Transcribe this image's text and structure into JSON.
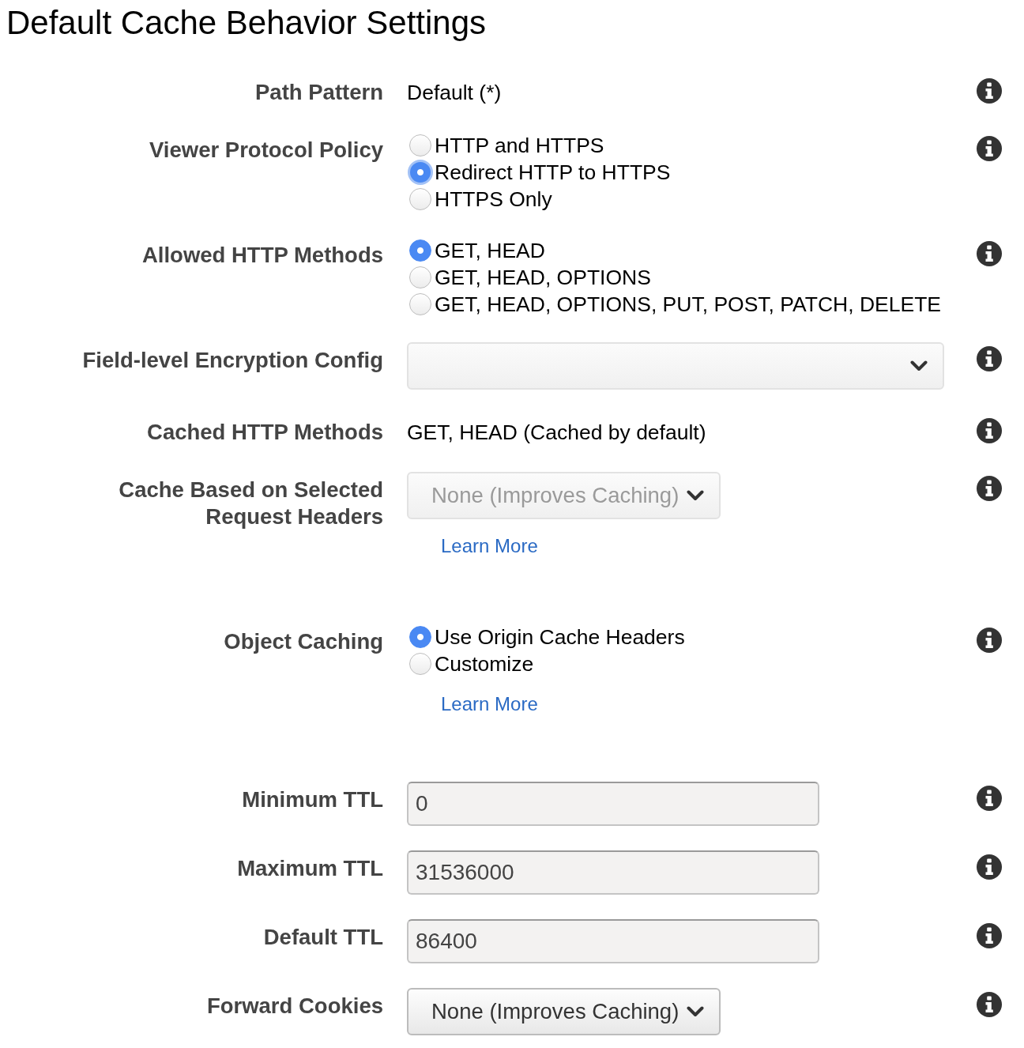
{
  "title": "Default Cache Behavior Settings",
  "fields": [
    {
      "kind": "text",
      "label": "Path Pattern",
      "value": "Default (*)"
    },
    {
      "kind": "radio",
      "label": "Viewer Protocol Policy",
      "options": [
        {
          "label": "HTTP and HTTPS",
          "selected": false,
          "focused": false
        },
        {
          "label": "Redirect HTTP to HTTPS",
          "selected": true,
          "focused": true
        },
        {
          "label": "HTTPS Only",
          "selected": false,
          "focused": false
        }
      ]
    },
    {
      "kind": "radio",
      "label": "Allowed HTTP Methods",
      "options": [
        {
          "label": "GET, HEAD",
          "selected": true
        },
        {
          "label": "GET, HEAD, OPTIONS",
          "selected": false
        },
        {
          "label": "GET, HEAD, OPTIONS, PUT, POST, PATCH, DELETE",
          "selected": false
        }
      ]
    },
    {
      "kind": "select",
      "label": "Field-level Encryption Config",
      "disabled": true
    },
    {
      "kind": "text",
      "label": "Cached HTTP Methods",
      "value": "GET, HEAD (Cached by default)"
    },
    {
      "kind": "select",
      "label": "Cache Based on Selected Request Headers",
      "value": "None (Improves Caching)",
      "disabled": true,
      "link": "Learn More"
    },
    {
      "kind": "radio",
      "label": "Object Caching",
      "options": [
        {
          "label": "Use Origin Cache Headers",
          "selected": true
        },
        {
          "label": "Customize",
          "selected": false
        }
      ],
      "link": "Learn More"
    },
    {
      "kind": "input",
      "label": "Minimum TTL",
      "value": "0",
      "disabled": true
    },
    {
      "kind": "input",
      "label": "Maximum TTL",
      "value": "31536000",
      "disabled": true
    },
    {
      "kind": "input",
      "label": "Default TTL",
      "value": "86400",
      "disabled": true
    },
    {
      "kind": "select",
      "label": "Forward Cookies",
      "value": "None (Improves Caching)",
      "disabled": false
    }
  ]
}
